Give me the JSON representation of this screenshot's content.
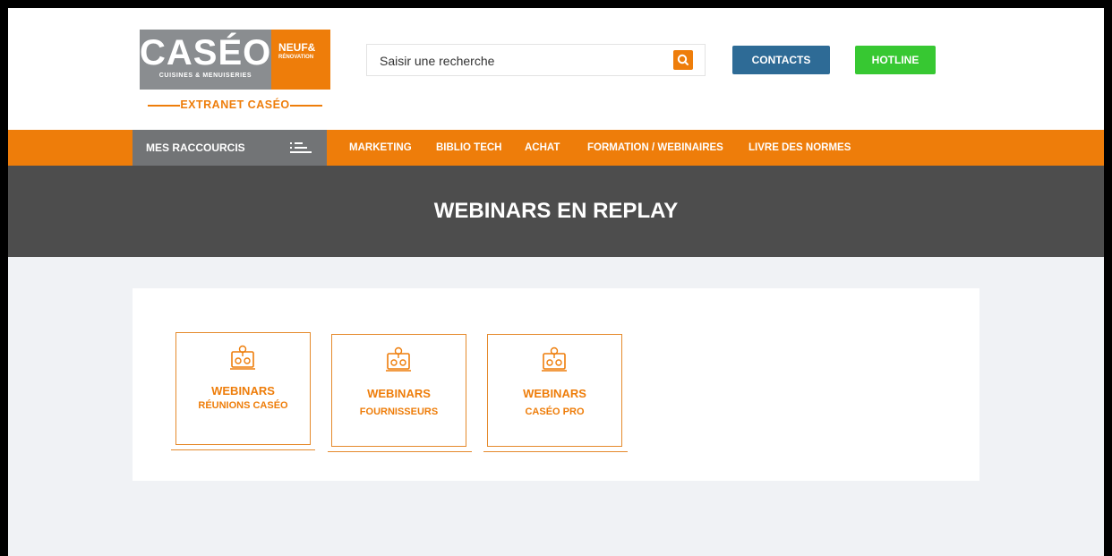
{
  "brand": {
    "logo_word": "CASÉO",
    "logo_sub": "CUISINES & MENUISERIES",
    "logo_neuf": "NEUF&",
    "logo_renovation": "RÉNOVATION",
    "extranet": "EXTRANET CASÉO"
  },
  "search": {
    "placeholder": "Saisir une recherche",
    "value": ""
  },
  "header_buttons": {
    "contacts": "CONTACTS",
    "hotline": "HOTLINE"
  },
  "nav": {
    "shortcuts_label": "MES RACCOURCIS",
    "items": [
      "MARKETING",
      "BIBLIO TECH",
      "ACHAT",
      "FORMATION / WEBINAIRES",
      "LIVRE DES NORMES"
    ]
  },
  "banner": {
    "title": "WEBINARS EN REPLAY"
  },
  "tiles": [
    {
      "line1": "WEBINARS",
      "line2": "RÉUNIONS CASÉO",
      "icon": "webinar-icon"
    },
    {
      "line1": "WEBINARS",
      "line2": "FOURNISSEURS",
      "icon": "webinar-icon"
    },
    {
      "line1": "WEBINARS",
      "line2": "CASÉO PRO",
      "icon": "webinar-icon"
    }
  ],
  "colors": {
    "orange": "#ee7d0a",
    "gray_logo": "#8a8d90",
    "contacts_blue": "#2e6b96",
    "hotline_green": "#37c832",
    "banner_gray": "#4d4d4d",
    "shortcut_gray": "#727476",
    "content_bg": "#f0f2f5"
  }
}
